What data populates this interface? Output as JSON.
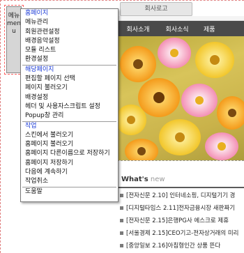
{
  "page": {
    "logo_text": "회사로고",
    "nav": [
      "회사소개",
      "회사소식",
      "제품"
    ],
    "whats_new": {
      "title": "What's",
      "title_suffix": " new"
    },
    "news": [
      "[전자신문 2.10] 인터네소핑, 디지털기기 경",
      "[디지털타임스 2.11]전자금융시장 새판짜기",
      "[전자신문 2.15]은행PG사 에스크로 제휴",
      "[서울경제 2.15]CEO기고-전자상거래의 미리",
      "[중앙일보 2.16]아침형인간 상품 뜬다"
    ]
  },
  "side_button": {
    "label": "메뉴 menu"
  },
  "menu": {
    "sections": [
      {
        "title": "홈페이지",
        "items": [
          "메뉴관리",
          "회원관련설정",
          "배경음악설정",
          "모듈 리스트",
          "환경설정"
        ]
      },
      {
        "title": "해당페이지",
        "items": [
          "편집할 페이지 선택",
          "페이지 불러오기",
          "배경설정",
          "헤더 및 사용자스크립트 설정",
          "Popup창 관리"
        ]
      },
      {
        "title": "작업",
        "items": [
          "스킨에서 불러오기",
          "홈페이지 불러오기",
          "홈페이지 다른이름으로 저장하기",
          "홈페이지 저장하기",
          "다음에 계속하기",
          "작업취소"
        ]
      }
    ],
    "footer_item": "도움말"
  },
  "colors": {
    "section_title": "#1a3ad6",
    "navbar": "#4a4a4a",
    "menu_border": "#7a7a7a",
    "dashed_guides": "#e08080"
  }
}
